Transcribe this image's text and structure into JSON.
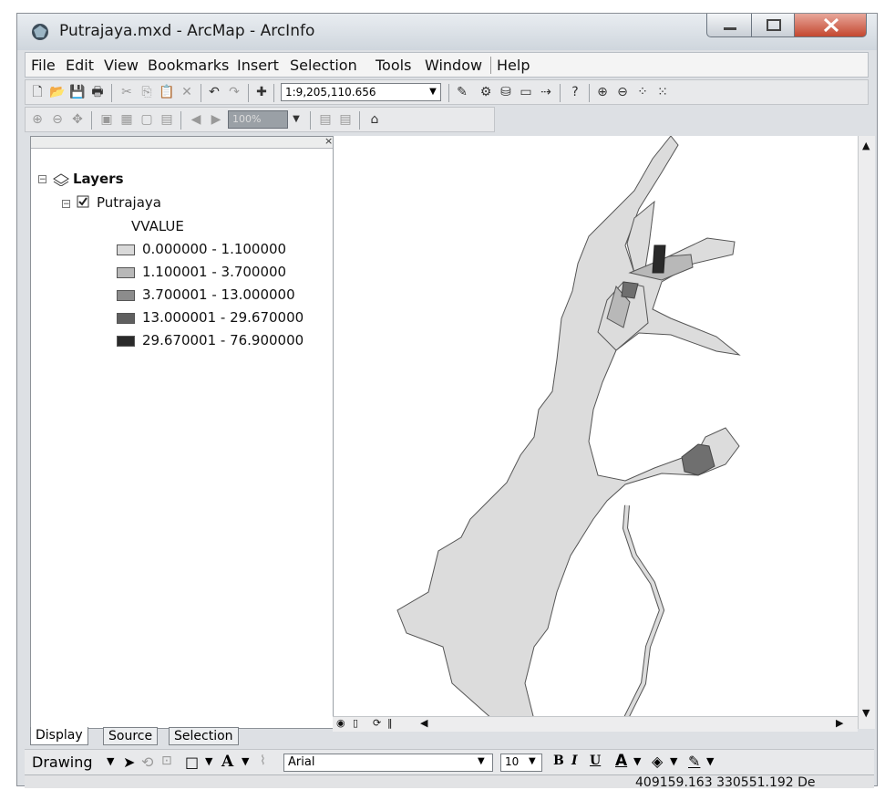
{
  "window": {
    "title": "Putrajaya.mxd - ArcMap - ArcInfo"
  },
  "menu": {
    "items": [
      "File",
      "Edit",
      "View",
      "Bookmarks",
      "Insert",
      "Selection",
      "Tools",
      "Window",
      "Help"
    ]
  },
  "toolbar": {
    "scale": "1:9,205,110.656",
    "zoom_percent": "100%"
  },
  "toc": {
    "root_label": "Layers",
    "layer_label": "Putrajaya",
    "field_label": "VVALUE",
    "classes": [
      {
        "label": "0.000000 - 1.100000",
        "color": "#d9d9d9"
      },
      {
        "label": "1.100001 - 3.700000",
        "color": "#b8b8b8"
      },
      {
        "label": "3.700001 - 13.000000",
        "color": "#8c8c8c"
      },
      {
        "label": "13.000001 - 29.670000",
        "color": "#5f5f5f"
      },
      {
        "label": "29.670001 - 76.900000",
        "color": "#2a2a2a"
      }
    ]
  },
  "tabs": [
    "Display",
    "Source",
    "Selection"
  ],
  "drawing": {
    "label": "Drawing",
    "font_name": "Arial",
    "font_size": "10",
    "bold": "B",
    "italic": "I",
    "underline": "U"
  },
  "status": {
    "coords": "409159.163  330551.192 De"
  }
}
